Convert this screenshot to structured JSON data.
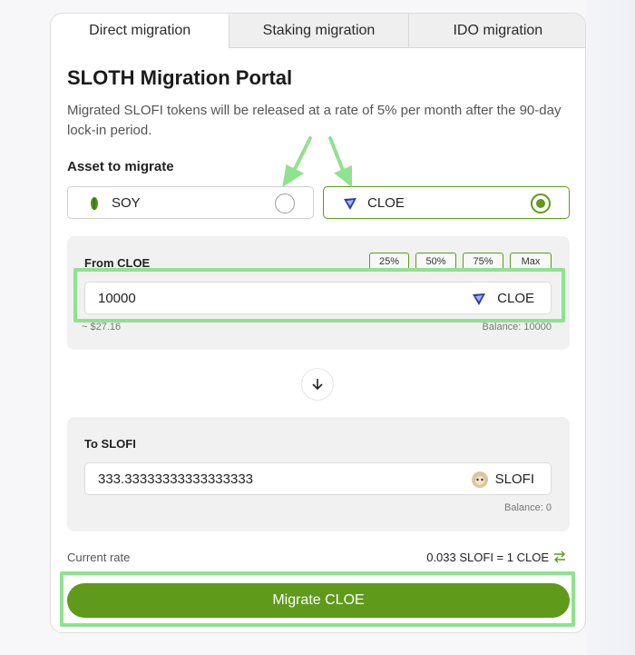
{
  "tabs": [
    {
      "label": "Direct migration",
      "active": true
    },
    {
      "label": "Staking migration",
      "active": false
    },
    {
      "label": "IDO migration",
      "active": false
    }
  ],
  "title": "SLOTH Migration Portal",
  "description": "Migrated SLOFI tokens will be released at a rate of 5% per month after the 90-day lock-in period.",
  "asset": {
    "label": "Asset to migrate",
    "options": [
      {
        "name": "SOY",
        "selected": false,
        "icon": "soy-leaf-icon"
      },
      {
        "name": "CLOE",
        "selected": true,
        "icon": "cloe-logo-icon"
      }
    ]
  },
  "from": {
    "label": "From CLOE",
    "percent_buttons": [
      "25%",
      "50%",
      "75%",
      "Max"
    ],
    "amount": "10000",
    "token": "CLOE",
    "usd": "~ $27.16",
    "balance": "Balance: 10000"
  },
  "to": {
    "label": "To SLOFI",
    "amount": "333.33333333333333333",
    "token": "SLOFI",
    "balance": "Balance: 0"
  },
  "rate": {
    "label": "Current rate",
    "value": "0.033 SLOFI = 1 CLOE"
  },
  "migrate_button": "Migrate CLOE",
  "colors": {
    "accent": "#5f9a1a",
    "highlight": "#8fe28f",
    "panel": "#f1f1f1"
  }
}
